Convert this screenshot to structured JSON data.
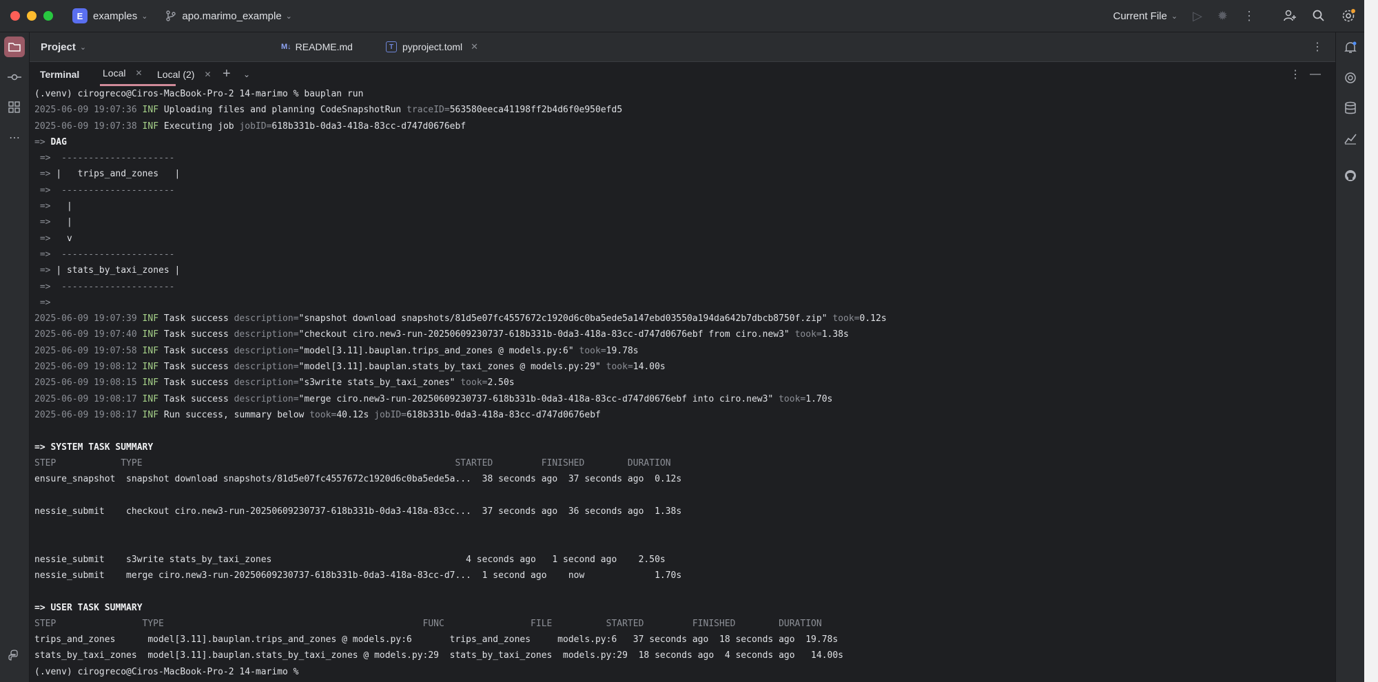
{
  "titlebar": {
    "project_badge": "E",
    "project_name": "examples",
    "branch": "apo.marimo_example",
    "run_config": "Current File"
  },
  "editor": {
    "project_label": "Project",
    "tabs": [
      {
        "label": "README.md",
        "icon": "markdown-icon"
      },
      {
        "label": "pyproject.toml",
        "icon": "toml-icon"
      }
    ]
  },
  "terminal": {
    "title": "Terminal",
    "tabs": [
      {
        "label": "Local"
      },
      {
        "label": "Local (2)"
      }
    ]
  },
  "lines": [
    [
      {
        "t": "(.venv) cirogreco@Ciros-MacBook-Pro-2 14-marimo % bauplan run"
      }
    ],
    [
      {
        "t": "2025-06-09 19:07:36 ",
        "c": "dim"
      },
      {
        "t": "INF",
        "c": "inf"
      },
      {
        "t": " Uploading files and planning CodeSnapshotRun "
      },
      {
        "t": "traceID=",
        "c": "dim"
      },
      {
        "t": "563580eeca41198ff2b4d6f0e950efd5"
      }
    ],
    [
      {
        "t": "2025-06-09 19:07:38 ",
        "c": "dim"
      },
      {
        "t": "INF",
        "c": "inf"
      },
      {
        "t": " Executing job "
      },
      {
        "t": "jobID=",
        "c": "dim"
      },
      {
        "t": "618b331b-0da3-418a-83cc-d747d0676ebf"
      }
    ],
    [
      {
        "t": "=> ",
        "c": "arrow"
      },
      {
        "t": "DAG",
        "c": "bold"
      }
    ],
    [
      {
        "t": " =>  ---------------------",
        "c": "arrow"
      }
    ],
    [
      {
        "t": " => ",
        "c": "arrow"
      },
      {
        "t": "|   trips_and_zones   |"
      }
    ],
    [
      {
        "t": " =>  ---------------------",
        "c": "arrow"
      }
    ],
    [
      {
        "t": " => ",
        "c": "arrow"
      },
      {
        "t": "  |"
      }
    ],
    [
      {
        "t": " => ",
        "c": "arrow"
      },
      {
        "t": "  |"
      }
    ],
    [
      {
        "t": " => ",
        "c": "arrow"
      },
      {
        "t": "  v"
      }
    ],
    [
      {
        "t": " =>  ---------------------",
        "c": "arrow"
      }
    ],
    [
      {
        "t": " => ",
        "c": "arrow"
      },
      {
        "t": "| stats_by_taxi_zones |"
      }
    ],
    [
      {
        "t": " =>  ---------------------",
        "c": "arrow"
      }
    ],
    [
      {
        "t": " =>",
        "c": "arrow"
      }
    ],
    [
      {
        "t": "2025-06-09 19:07:39 ",
        "c": "dim"
      },
      {
        "t": "INF",
        "c": "inf"
      },
      {
        "t": " Task success "
      },
      {
        "t": "description=",
        "c": "dim"
      },
      {
        "t": "\"snapshot download snapshots/81d5e07fc4557672c1920d6c0ba5ede5a147ebd03550a194da642b7dbcb8750f.zip\" "
      },
      {
        "t": "took=",
        "c": "dim"
      },
      {
        "t": "0.12s"
      }
    ],
    [
      {
        "t": "2025-06-09 19:07:40 ",
        "c": "dim"
      },
      {
        "t": "INF",
        "c": "inf"
      },
      {
        "t": " Task success "
      },
      {
        "t": "description=",
        "c": "dim"
      },
      {
        "t": "\"checkout ciro.new3-run-20250609230737-618b331b-0da3-418a-83cc-d747d0676ebf from ciro.new3\" "
      },
      {
        "t": "took=",
        "c": "dim"
      },
      {
        "t": "1.38s"
      }
    ],
    [
      {
        "t": "2025-06-09 19:07:58 ",
        "c": "dim"
      },
      {
        "t": "INF",
        "c": "inf"
      },
      {
        "t": " Task success "
      },
      {
        "t": "description=",
        "c": "dim"
      },
      {
        "t": "\"model[3.11].bauplan.trips_and_zones @ models.py:6\" "
      },
      {
        "t": "took=",
        "c": "dim"
      },
      {
        "t": "19.78s"
      }
    ],
    [
      {
        "t": "2025-06-09 19:08:12 ",
        "c": "dim"
      },
      {
        "t": "INF",
        "c": "inf"
      },
      {
        "t": " Task success "
      },
      {
        "t": "description=",
        "c": "dim"
      },
      {
        "t": "\"model[3.11].bauplan.stats_by_taxi_zones @ models.py:29\" "
      },
      {
        "t": "took=",
        "c": "dim"
      },
      {
        "t": "14.00s"
      }
    ],
    [
      {
        "t": "2025-06-09 19:08:15 ",
        "c": "dim"
      },
      {
        "t": "INF",
        "c": "inf"
      },
      {
        "t": " Task success "
      },
      {
        "t": "description=",
        "c": "dim"
      },
      {
        "t": "\"s3write stats_by_taxi_zones\" "
      },
      {
        "t": "took=",
        "c": "dim"
      },
      {
        "t": "2.50s"
      }
    ],
    [
      {
        "t": "2025-06-09 19:08:17 ",
        "c": "dim"
      },
      {
        "t": "INF",
        "c": "inf"
      },
      {
        "t": " Task success "
      },
      {
        "t": "description=",
        "c": "dim"
      },
      {
        "t": "\"merge ciro.new3-run-20250609230737-618b331b-0da3-418a-83cc-d747d0676ebf into ciro.new3\" "
      },
      {
        "t": "took=",
        "c": "dim"
      },
      {
        "t": "1.70s"
      }
    ],
    [
      {
        "t": "2025-06-09 19:08:17 ",
        "c": "dim"
      },
      {
        "t": "INF",
        "c": "inf"
      },
      {
        "t": " Run success, summary below "
      },
      {
        "t": "took=",
        "c": "dim"
      },
      {
        "t": "40.12s "
      },
      {
        "t": "jobID=",
        "c": "dim"
      },
      {
        "t": "618b331b-0da3-418a-83cc-d747d0676ebf"
      }
    ],
    [],
    [
      {
        "t": "=> SYSTEM TASK SUMMARY",
        "c": "bold"
      }
    ],
    [
      {
        "t": "STEP            TYPE                                                          STARTED         FINISHED        DURATION",
        "c": "dim"
      }
    ],
    [
      {
        "t": "ensure_snapshot  snapshot download snapshots/81d5e07fc4557672c1920d6c0ba5ede5a...  38 seconds ago  37 seconds ago  0.12s"
      }
    ],
    [],
    [
      {
        "t": "nessie_submit    checkout ciro.new3-run-20250609230737-618b331b-0da3-418a-83cc...  37 seconds ago  36 seconds ago  1.38s"
      }
    ],
    [],
    [],
    [
      {
        "t": "nessie_submit    s3write stats_by_taxi_zones                                    4 seconds ago   1 second ago    2.50s"
      }
    ],
    [
      {
        "t": "nessie_submit    merge ciro.new3-run-20250609230737-618b331b-0da3-418a-83cc-d7...  1 second ago    now             1.70s"
      }
    ],
    [],
    [
      {
        "t": "=> USER TASK SUMMARY",
        "c": "bold"
      }
    ],
    [
      {
        "t": "STEP                TYPE                                                FUNC                FILE          STARTED         FINISHED        DURATION",
        "c": "dim"
      }
    ],
    [
      {
        "t": "trips_and_zones      model[3.11].bauplan.trips_and_zones @ models.py:6       trips_and_zones     models.py:6   37 seconds ago  18 seconds ago  19.78s"
      }
    ],
    [
      {
        "t": "stats_by_taxi_zones  model[3.11].bauplan.stats_by_taxi_zones @ models.py:29  stats_by_taxi_zones  models.py:29  18 seconds ago  4 seconds ago   14.00s"
      }
    ],
    [
      {
        "t": "(.venv) cirogreco@Ciros-MacBook-Pro-2 14-marimo % "
      }
    ]
  ]
}
